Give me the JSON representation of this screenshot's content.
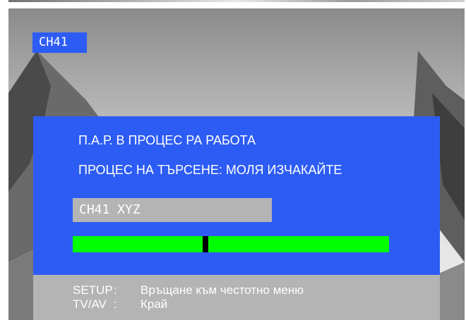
{
  "channel_badge": "CH41",
  "dialog": {
    "line1": "П.А.Р. В ПРОЦЕС РА РАБОТА",
    "line2": "ПРОЦЕС НА ТЪРСЕНЕ: МОЛЯ ИЗЧАКАЙТЕ",
    "channel_field": "CH41   XYZ",
    "progress_fraction": 0.42
  },
  "footer": {
    "items": [
      {
        "key": "SETUP",
        "sep": ":",
        "action": "Връщане към честотно меню"
      },
      {
        "key": "TV/AV",
        "sep": ":",
        "action": "Край"
      }
    ]
  },
  "colors": {
    "osd_blue": "#2d5cf4",
    "field_gray": "#b4b4b4",
    "progress_green": "#00ff00"
  }
}
